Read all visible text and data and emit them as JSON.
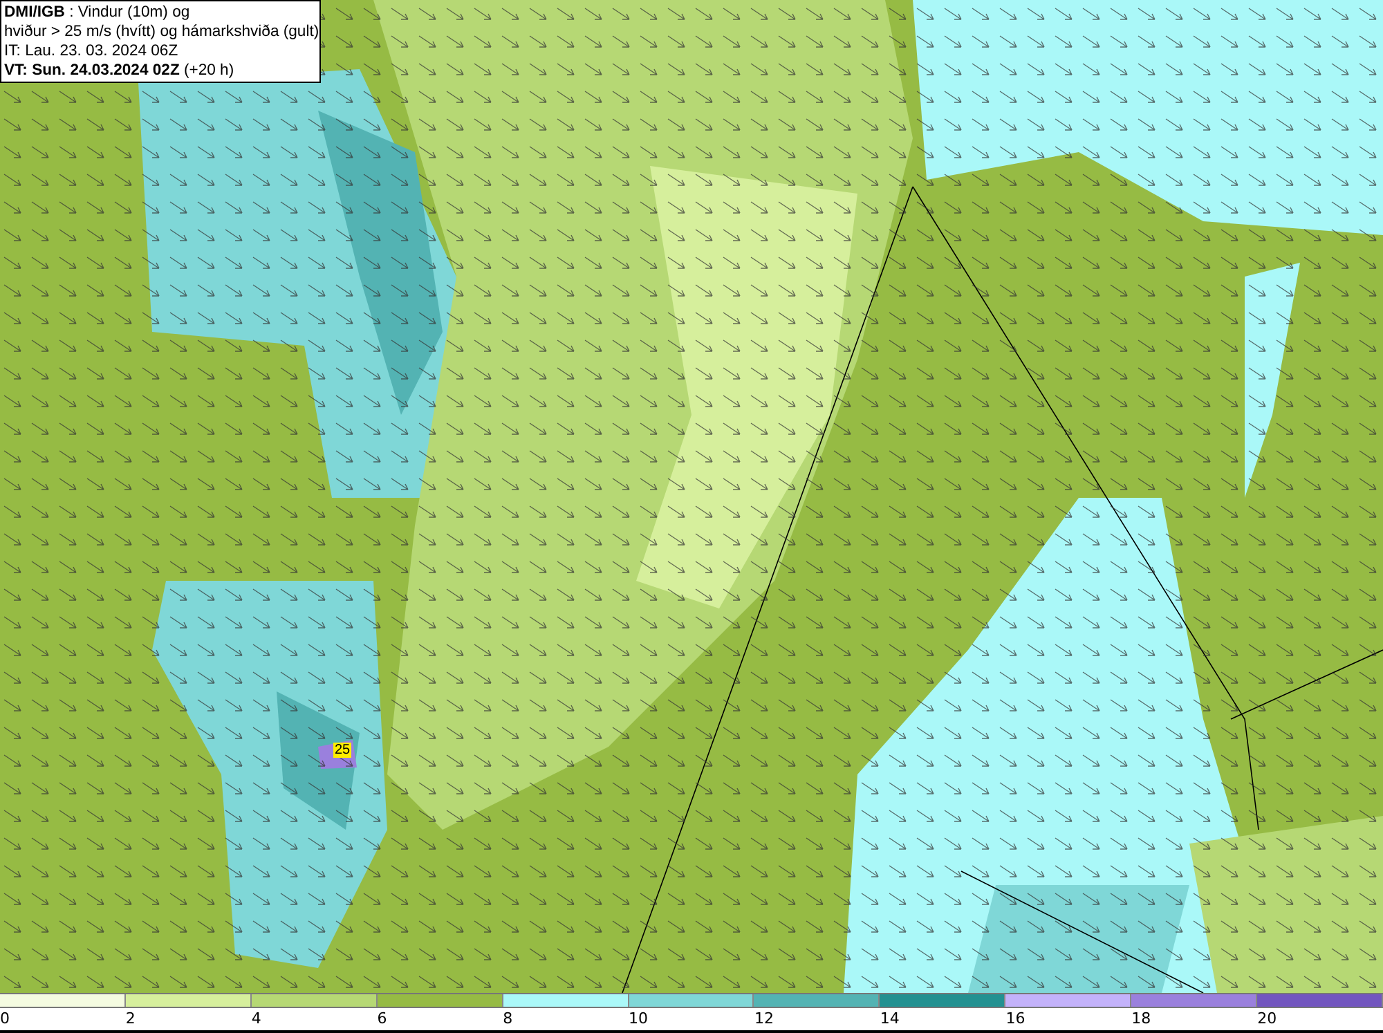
{
  "title_box": {
    "lines": [
      "**DMI/IGB** : Vindur (10m) og",
      "hviður > 25 m/s (hvítt) og hámarkshviða (gult)",
      "IT: Lau. 23. 03. 2024 06Z",
      "**VT: Sun. 24.03.2024 02Z** (+20 h)"
    ]
  },
  "map": {
    "gust_label": "25"
  },
  "legend": {
    "bins": [
      {
        "color": "#f4fbe0",
        "label": "0"
      },
      {
        "color": "#d6ef9c",
        "label": "2"
      },
      {
        "color": "#b6d874",
        "label": "4"
      },
      {
        "color": "#96bb44",
        "label": "6"
      },
      {
        "color": "#aaf8f8",
        "label": "8"
      },
      {
        "color": "#7fd7d7",
        "label": "10"
      },
      {
        "color": "#53b3b3",
        "label": "12"
      },
      {
        "color": "#239191",
        "label": "14"
      },
      {
        "color": "#c3b2fa",
        "label": "16"
      },
      {
        "color": "#9a80dd",
        "label": "18"
      },
      {
        "color": "#7256bf",
        "label": "20"
      }
    ]
  }
}
